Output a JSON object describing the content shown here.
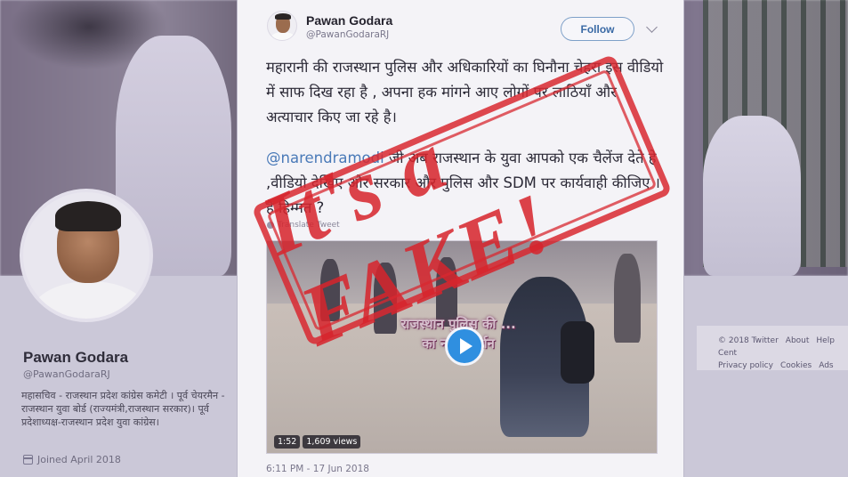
{
  "profile": {
    "name": "Pawan Godara",
    "handle": "@PawanGodaraRJ",
    "bio": "महासचिव - राजस्थान प्रदेश कांग्रेस कमेटी । पूर्व चेयरमैन - राजस्थान युवा बोर्ड (राज्यमंत्री,राजस्थान सरकार)। पूर्व प्रदेशाध्यक्ष-राजस्थान प्रदेश युवा कांग्रेस।",
    "joined": "Joined April 2018"
  },
  "footer": {
    "links": [
      "© 2018 Twitter",
      "About",
      "Help Cent",
      "Privacy policy",
      "Cookies",
      "Ads"
    ]
  },
  "tweet": {
    "author_name": "Pawan Godara",
    "author_handle": "@PawanGodaraRJ",
    "follow_label": "Follow",
    "paragraph1": "महारानी की राजस्थान पुलिस और अधिकारियों का घिनौना चेहरा इस वीडियो में साफ दिख रहा है , अपना हक मांगने आए लोगों पर लाठियाँ और अत्याचार किए जा रहे है।",
    "mention": "@narendramodi",
    "paragraph2_rest": " जी अब राजस्थान के युवा आपको एक चैलेंज देते हे ,वीडियो देखिए और सरकार और पुलिस और SDM पर कार्यवाही कीजिए ।है हिम्मत ?",
    "translate_label": "Translate Tweet",
    "video": {
      "caption": "राजस्थान पुलिस की ... का नग्न प्रदर्शन",
      "duration": "1:52",
      "views": "1,609 views"
    },
    "timestamp": "6:11 PM - 17 Jun 2018"
  },
  "stamp": {
    "text": "It's a FAKE!"
  },
  "colors": {
    "stamp_red": "#d6242c",
    "link_blue": "#4a7ab8",
    "play_blue": "#2f8fe0"
  }
}
